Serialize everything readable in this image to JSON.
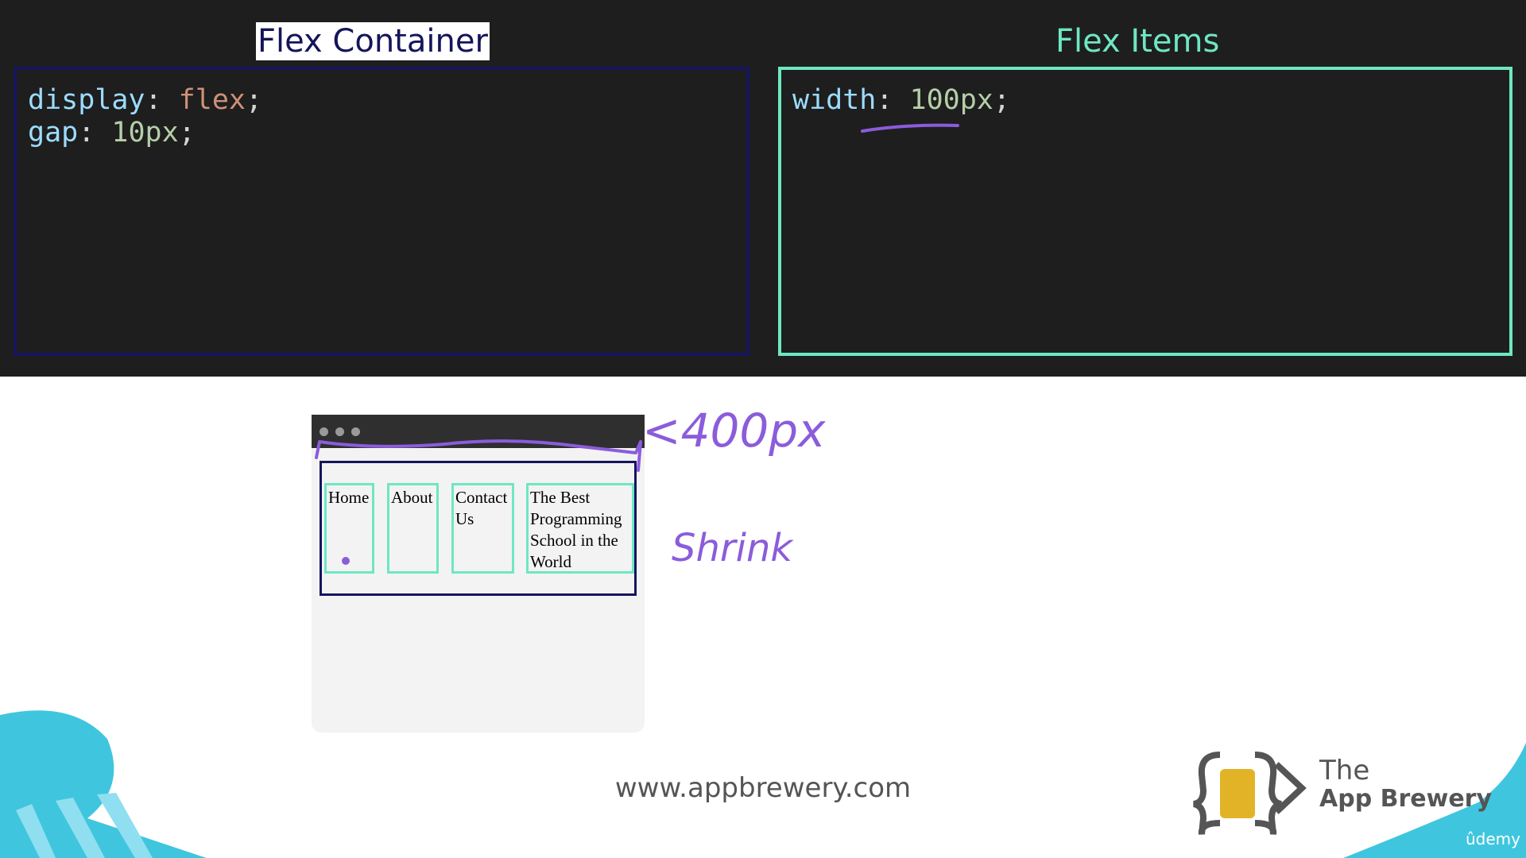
{
  "headings": {
    "container": "Flex Container",
    "items": "Flex Items"
  },
  "container_panel": {
    "line1": {
      "prop": "display",
      "colon": ": ",
      "value": "flex",
      "semi": ";"
    },
    "line2": {
      "prop": "gap",
      "colon": ": ",
      "value": "10px",
      "semi": ";"
    }
  },
  "items_panel": {
    "line1": {
      "prop": "width",
      "colon": ": ",
      "value": "100px",
      "semi": ";"
    }
  },
  "browser": {
    "nav_items": [
      "Home",
      "About",
      "Contact Us",
      "The Best Programming School in the World"
    ]
  },
  "annotations": {
    "width_note": "<400px",
    "shrink_note": "Shrink"
  },
  "footer": {
    "url": "www.appbrewery.com",
    "brand_the": "The",
    "brand_name": "App Brewery",
    "udemy": "ûdemy"
  },
  "colors": {
    "dark_bg": "#1e1e1e",
    "container_accent": "#15155e",
    "items_accent": "#6ee7c2",
    "annotation": "#8b5cdb",
    "brand_yellow": "#e3b327"
  },
  "icons": {
    "brand_logo": "curly-braces-beer-icon",
    "browser_dots": "window-dots-icon"
  }
}
